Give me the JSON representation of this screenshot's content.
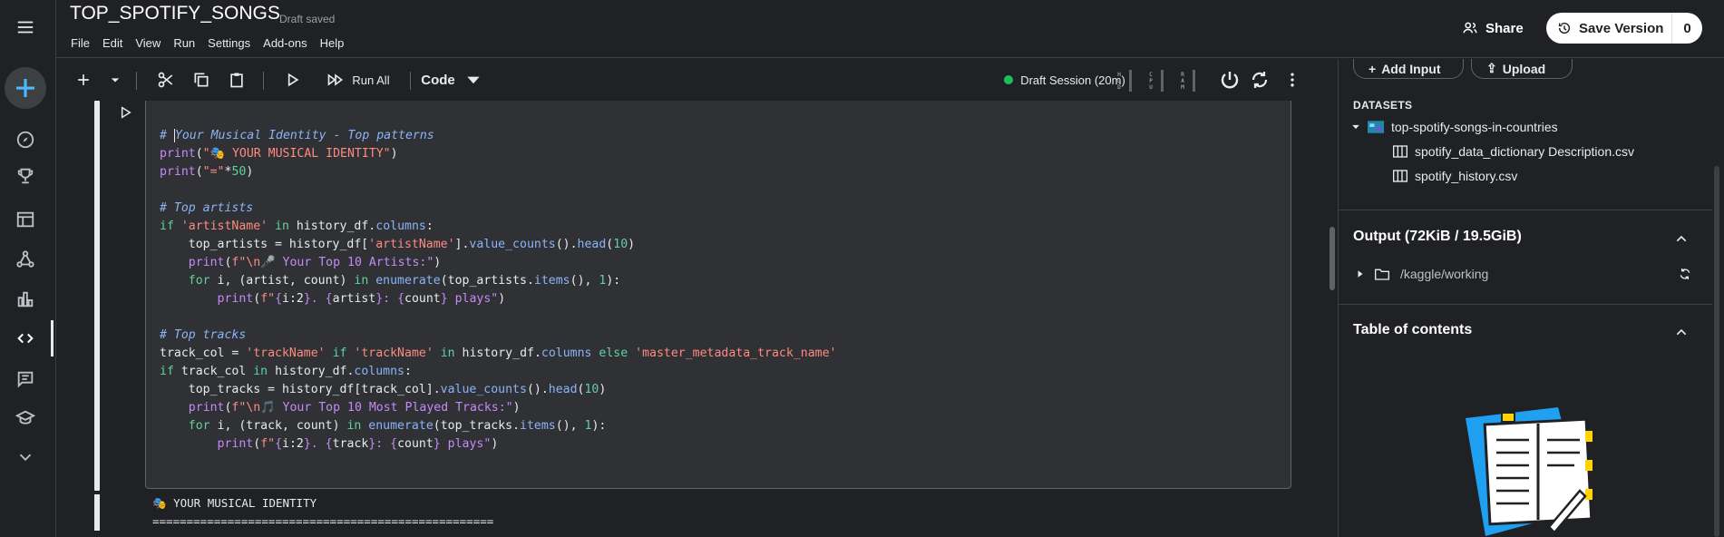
{
  "header": {
    "title": "TOP_SPOTIFY_SONGS",
    "draft_status": "Draft saved",
    "menu": [
      "File",
      "Edit",
      "View",
      "Run",
      "Settings",
      "Add-ons",
      "Help"
    ],
    "share_label": "Share",
    "save_label": "Save Version",
    "save_count": "0"
  },
  "toolbar": {
    "run_all_label": "Run All",
    "cell_type": "Code",
    "session_label": "Draft Session (20m)",
    "meters": [
      "HDD",
      "CPU",
      "RAM"
    ]
  },
  "code_lines": [
    "# Your Musical Identity - Top patterns",
    "print(\"🎭 YOUR MUSICAL IDENTITY\")",
    "print(\"=\"*50)",
    "",
    "# Top artists",
    "if 'artistName' in history_df.columns:",
    "    top_artists = history_df['artistName'].value_counts().head(10)",
    "    print(f\"\\n🎤 Your Top 10 Artists:\")",
    "    for i, (artist, count) in enumerate(top_artists.items(), 1):",
    "        print(f\"{i:2}. {artist}: {count} plays\")",
    "",
    "# Top tracks",
    "track_col = 'trackName' if 'trackName' in history_df.columns else 'master_metadata_track_name'",
    "if track_col in history_df.columns:",
    "    top_tracks = history_df[track_col].value_counts().head(10)",
    "    print(f\"\\n🎵 Your Top 10 Most Played Tracks:\")",
    "    for i, (track, count) in enumerate(top_tracks.items(), 1):",
    "        print(f\"{i:2}. {track}: {count} plays\")"
  ],
  "output": {
    "line1": "🎭 YOUR MUSICAL IDENTITY",
    "line2": "=================================================="
  },
  "panel": {
    "add_input_label": "Add Input",
    "upload_label": "Upload",
    "datasets_label": "DATASETS",
    "dataset_name": "top-spotify-songs-in-countries",
    "files": [
      "spotify_data_dictionary Description.csv",
      "spotify_history.csv"
    ],
    "output_title": "Output (72KiB / 19.5GiB)",
    "output_path": "/kaggle/working",
    "toc_title": "Table of contents"
  },
  "colors": {
    "background": "#202124",
    "editor": "#303134",
    "session_dot": "#1bbf5a",
    "comment": "#8ab4f8",
    "keyword": "#5dd39e",
    "string": "#ff8a80"
  }
}
